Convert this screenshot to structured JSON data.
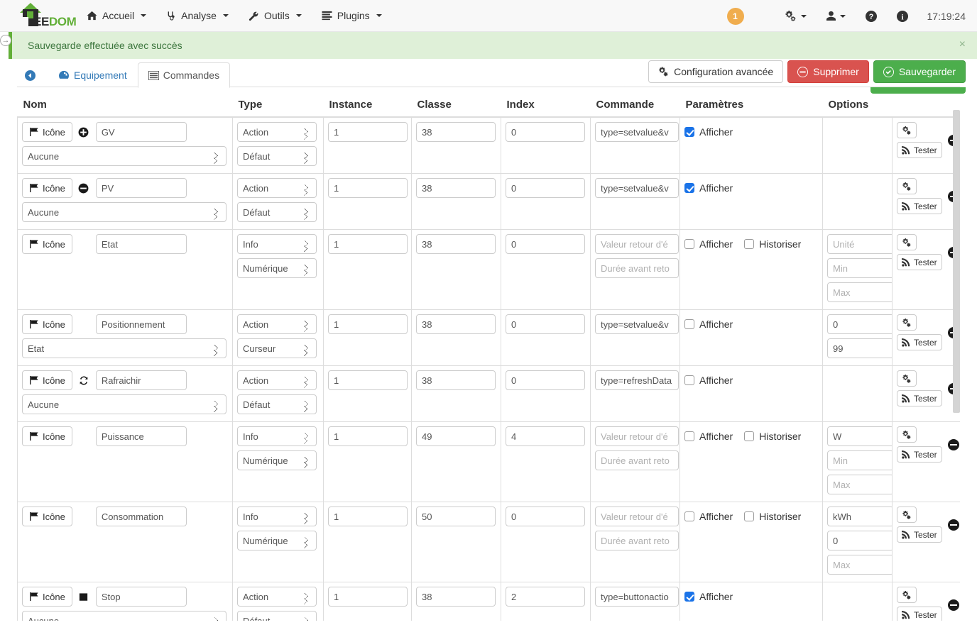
{
  "brand": {
    "ee": "EE",
    "dom": "DOM"
  },
  "navbar": {
    "items": [
      {
        "label": "Accueil",
        "icon": "home-icon"
      },
      {
        "label": "Analyse",
        "icon": "stethoscope-icon"
      },
      {
        "label": "Outils",
        "icon": "wrench-icon"
      },
      {
        "label": "Plugins",
        "icon": "list-icon"
      }
    ],
    "badge_count": "1",
    "clock": "17:19:24",
    "right_icons": [
      "gears-icon",
      "user-icon",
      "question-circle-icon",
      "info-circle-icon"
    ]
  },
  "alert": {
    "message": "Sauvegarde effectuée avec succès",
    "close": "×"
  },
  "panel_toggle": "→",
  "tabs": [
    {
      "label": "",
      "icon": "back-arrow-icon",
      "active": false
    },
    {
      "label": "Equipement",
      "icon": "dashboard-icon",
      "active": false
    },
    {
      "label": "Commandes",
      "icon": "table-icon",
      "active": true
    }
  ],
  "toolbar": {
    "advanced_label": "Configuration avancée",
    "delete_label": "Supprimer",
    "save_label": "Sauvegarder"
  },
  "colors": {
    "brand_green": "#62af38",
    "success": "#4cae4c",
    "danger": "#d9534f",
    "warning": "#f0ad4e",
    "link": "#337ab7",
    "checkbox_blue": "#1a73e8"
  },
  "table": {
    "columns": [
      "Nom",
      "Type",
      "Instance",
      "Classe",
      "Index",
      "Commande",
      "Paramètres",
      "Options",
      ""
    ],
    "labels": {
      "icon_button": "Icône",
      "test_button": "Tester",
      "afficher": "Afficher",
      "historiser": "Historiser"
    },
    "placeholders": {
      "valeur_retour": "Valeur retour d'é",
      "duree_avant": "Durée avant reto",
      "unite": "Unité",
      "min": "Min",
      "max": "Max"
    },
    "rows": [
      {
        "glyph": "plus-circle-icon",
        "name": "GV",
        "subselect": "Aucune",
        "type": "Action",
        "subtype": "Défaut",
        "instance": "1",
        "classe": "38",
        "index": "0",
        "commande": "type=setvalue&v",
        "afficher": true,
        "has_historiser": false,
        "historiser": false,
        "options": [],
        "params_placeholder": false
      },
      {
        "glyph": "minus-circle-icon",
        "name": "PV",
        "subselect": "Aucune",
        "type": "Action",
        "subtype": "Défaut",
        "instance": "1",
        "classe": "38",
        "index": "0",
        "commande": "type=setvalue&v",
        "afficher": true,
        "has_historiser": false,
        "historiser": false,
        "options": [],
        "params_placeholder": false
      },
      {
        "glyph": "",
        "name": "Etat",
        "subselect": null,
        "type": "Info",
        "subtype": "Numérique",
        "instance": "1",
        "classe": "38",
        "index": "0",
        "commande": null,
        "afficher": false,
        "has_historiser": true,
        "historiser": false,
        "options": [
          {
            "value": "",
            "placeholder": "Unité"
          },
          {
            "value": "",
            "placeholder": "Min"
          },
          {
            "value": "",
            "placeholder": "Max"
          }
        ],
        "params_placeholder": true
      },
      {
        "glyph": "",
        "name": "Positionnement",
        "subselect": "Etat",
        "type": "Action",
        "subtype": "Curseur",
        "instance": "1",
        "classe": "38",
        "index": "0",
        "commande": "type=setvalue&v",
        "afficher": false,
        "has_historiser": false,
        "historiser": false,
        "options": [
          {
            "value": "0",
            "placeholder": "Min"
          },
          {
            "value": "99",
            "placeholder": "Max"
          }
        ],
        "params_placeholder": false
      },
      {
        "glyph": "refresh-icon",
        "name": "Rafraichir",
        "subselect": "Aucune",
        "type": "Action",
        "subtype": "Défaut",
        "instance": "1",
        "classe": "38",
        "index": "0",
        "commande": "type=refreshData",
        "afficher": false,
        "has_historiser": false,
        "historiser": false,
        "options": [],
        "params_placeholder": false
      },
      {
        "glyph": "",
        "name": "Puissance",
        "subselect": null,
        "type": "Info",
        "subtype": "Numérique",
        "instance": "1",
        "classe": "49",
        "index": "4",
        "commande": null,
        "afficher": false,
        "has_historiser": true,
        "historiser": false,
        "options": [
          {
            "value": "W",
            "placeholder": "Unité"
          },
          {
            "value": "",
            "placeholder": "Min"
          },
          {
            "value": "",
            "placeholder": "Max"
          }
        ],
        "params_placeholder": true
      },
      {
        "glyph": "",
        "name": "Consommation",
        "subselect": null,
        "type": "Info",
        "subtype": "Numérique",
        "instance": "1",
        "classe": "50",
        "index": "0",
        "commande": null,
        "afficher": false,
        "has_historiser": true,
        "historiser": false,
        "options": [
          {
            "value": "kWh",
            "placeholder": "Unité"
          },
          {
            "value": "0",
            "placeholder": "Min"
          },
          {
            "value": "",
            "placeholder": "Max"
          }
        ],
        "params_placeholder": true
      },
      {
        "glyph": "stop-square-icon",
        "name": "Stop",
        "subselect": "Aucune",
        "type": "Action",
        "subtype": "Défaut",
        "instance": "1",
        "classe": "38",
        "index": "2",
        "commande": "type=buttonactio",
        "afficher": true,
        "has_historiser": false,
        "historiser": false,
        "options": [],
        "params_placeholder": false
      }
    ]
  }
}
